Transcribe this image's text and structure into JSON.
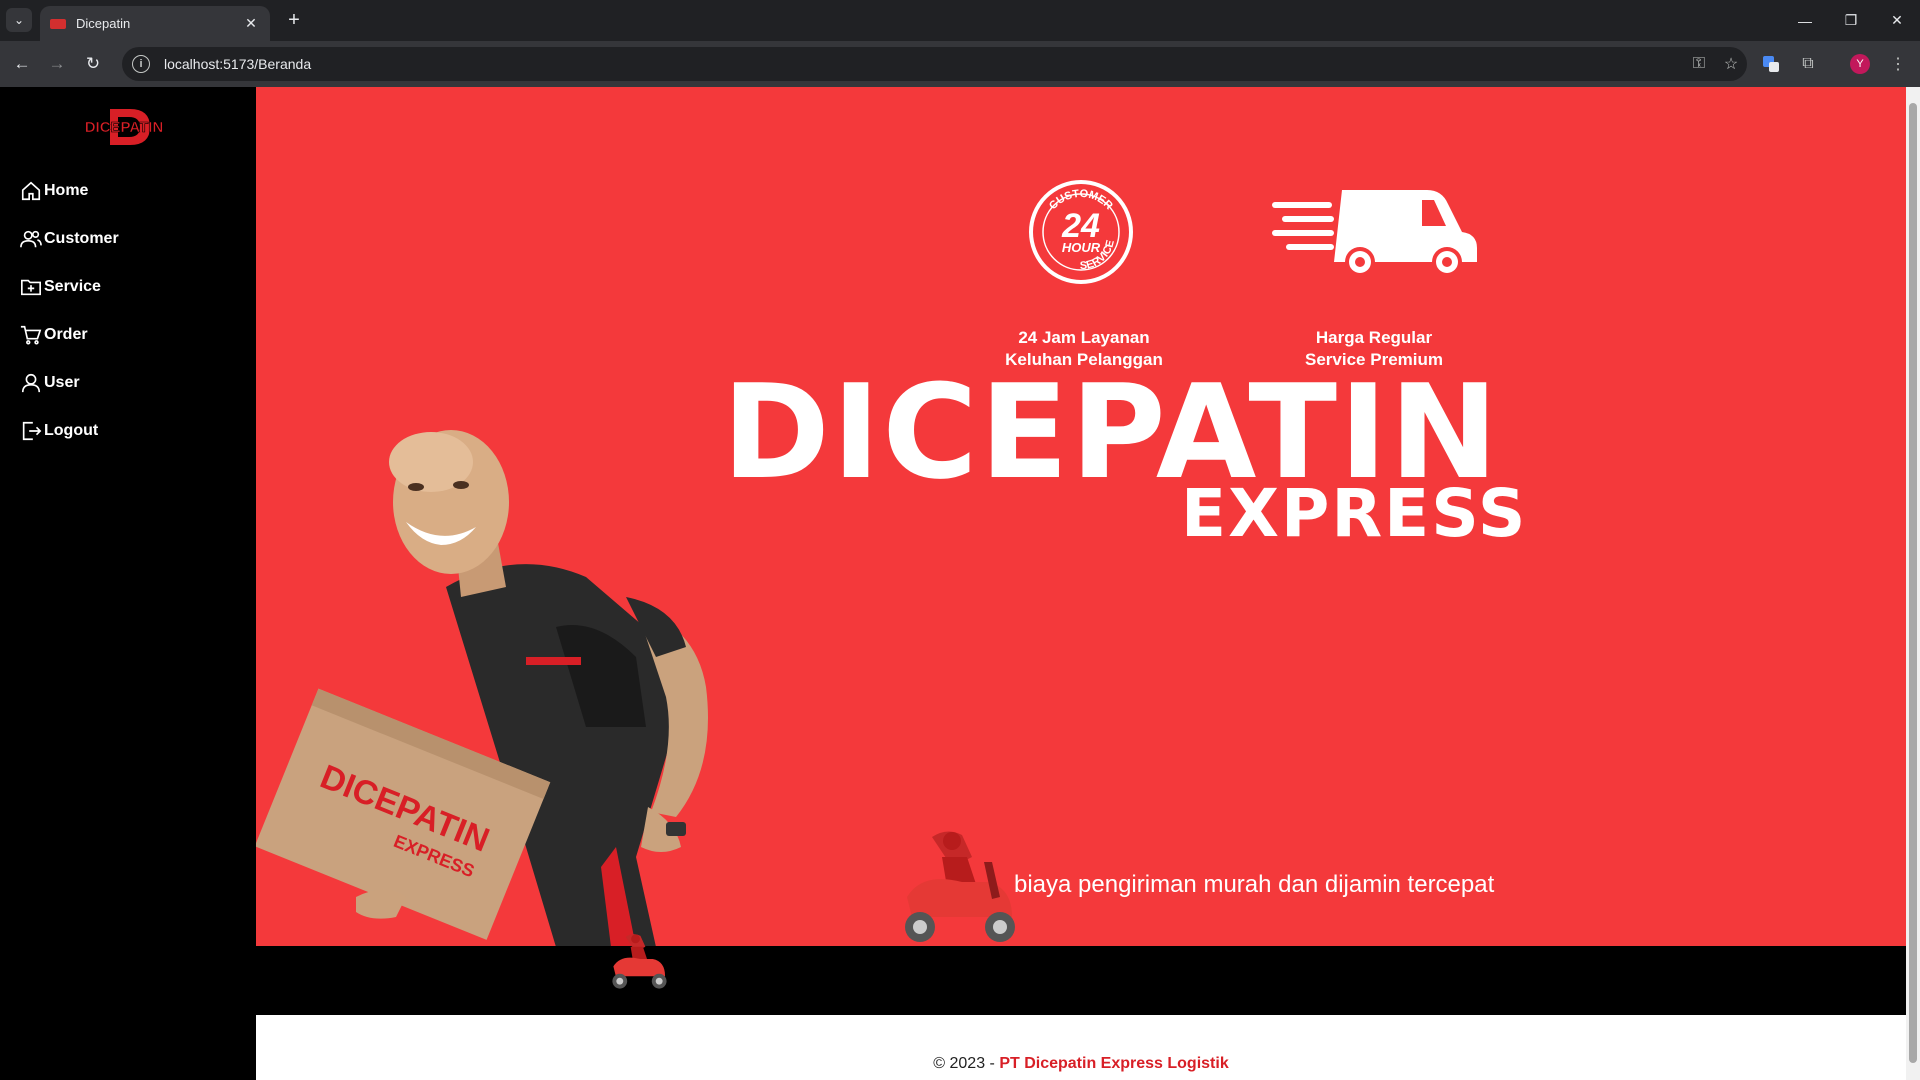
{
  "browser": {
    "tab_title": "Dicepatin",
    "url": "localhost:5173/Beranda",
    "profile_initial": "Y"
  },
  "sidebar": {
    "brand": "DICEPATIN",
    "items": [
      {
        "label": "Home",
        "icon": "home-icon"
      },
      {
        "label": "Customer",
        "icon": "users-icon"
      },
      {
        "label": "Service",
        "icon": "folder-plus-icon"
      },
      {
        "label": "Order",
        "icon": "cart-icon"
      },
      {
        "label": "User",
        "icon": "user-icon"
      },
      {
        "label": "Logout",
        "icon": "logout-icon"
      }
    ]
  },
  "hero": {
    "badge_text_top": "CUSTOMER",
    "badge_number": "24",
    "badge_hour": "HOUR",
    "badge_text_bottom": "SERVICE",
    "feature1_line1": "24 Jam Layanan",
    "feature1_line2": "Keluhan Pelanggan",
    "feature2_line1": "Harga Regular",
    "feature2_line2": "Service Premium",
    "title": "DICEPATIN",
    "subtitle": "EXPRESS",
    "box_brand": "DICEPATIN",
    "box_sub": "EXPRESS",
    "tagline": "biaya pengiriman murah dan dijamin tercepat"
  },
  "footer": {
    "prefix": "© 2023 - ",
    "company": "PT Dicepatin Express Logistik"
  },
  "colors": {
    "hero_red": "#f4393b",
    "brand_red": "#d81f26",
    "sidebar_bg": "#000000"
  }
}
